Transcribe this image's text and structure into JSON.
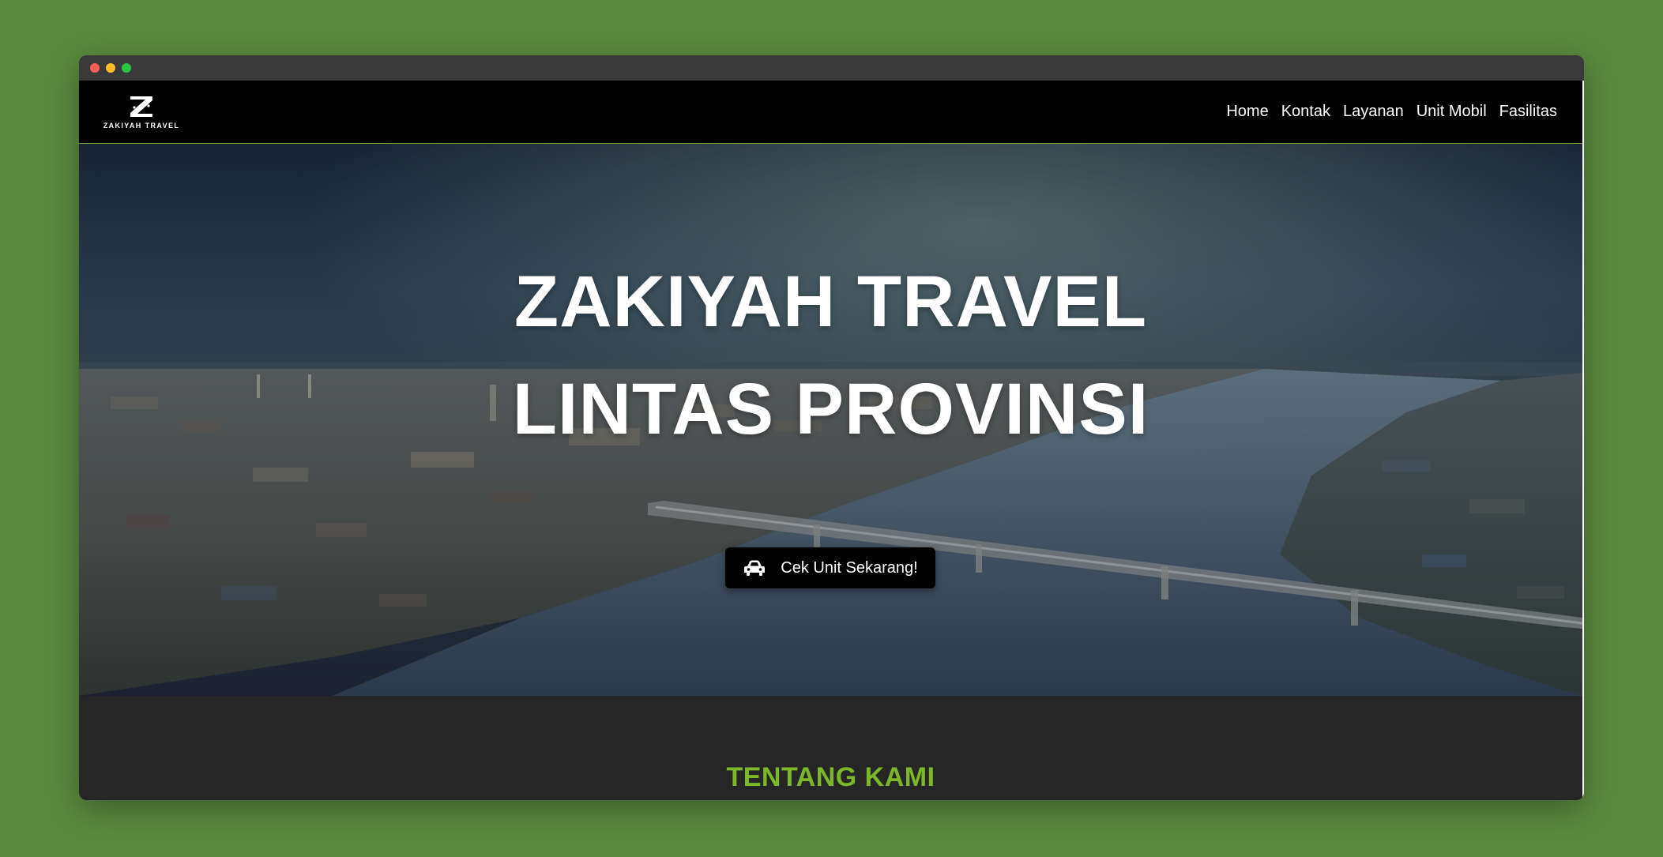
{
  "brand": {
    "logo_letter": "Z",
    "logo_text": "ZAKIYAH TRAVEL"
  },
  "nav": {
    "items": [
      {
        "label": "Home"
      },
      {
        "label": "Kontak"
      },
      {
        "label": "Layanan"
      },
      {
        "label": "Unit Mobil"
      },
      {
        "label": "Fasilitas"
      }
    ]
  },
  "hero": {
    "title_line1": "ZAKIYAH TRAVEL",
    "title_line2": "LINTAS PROVINSI",
    "cta_label": "Cek Unit Sekarang!",
    "cta_icon": "car-icon"
  },
  "about": {
    "title": "TENTANG KAMI"
  },
  "colors": {
    "page_background": "#5b8a3f",
    "navbar": "#000000",
    "accent_green": "#7cb82a",
    "section_background": "#262626"
  }
}
